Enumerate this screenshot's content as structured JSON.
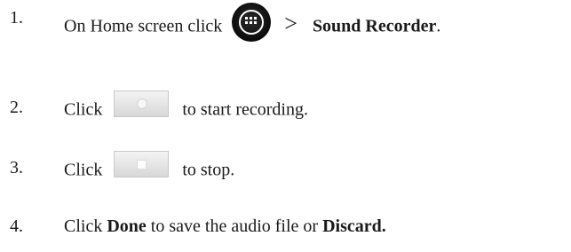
{
  "steps": [
    {
      "number": "1.",
      "prefix": "On Home screen click",
      "separator": ">",
      "target": "Sound Recorder",
      "suffix": "."
    },
    {
      "number": "2.",
      "prefix": "Click",
      "suffix": "to start recording."
    },
    {
      "number": "3.",
      "prefix": "Click",
      "suffix": "to stop."
    },
    {
      "number": "4.",
      "prefix": "Click",
      "done": "Done",
      "middle": "to save the audio file or",
      "discard": "Discard."
    }
  ],
  "icons": {
    "apps": "apps-icon",
    "record": "record-button-icon",
    "stop": "stop-button-icon"
  }
}
